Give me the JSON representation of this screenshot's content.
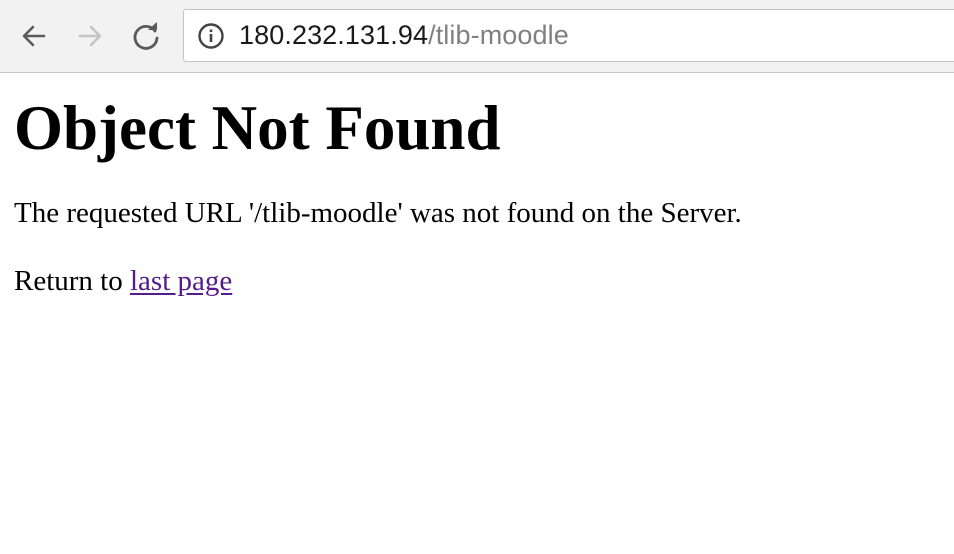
{
  "browser": {
    "url_host": "180.232.131.94",
    "url_path": "/tlib-moodle",
    "icons": {
      "back": "back-arrow-icon",
      "forward": "forward-arrow-icon",
      "reload": "reload-icon",
      "site_info": "info-icon"
    },
    "forward_enabled": false
  },
  "page": {
    "heading": "Object Not Found",
    "message": "The requested URL '/tlib-moodle' was not found on the Server.",
    "return_prefix": "Return to ",
    "return_link": "last page",
    "link_color": "#551a8b"
  }
}
